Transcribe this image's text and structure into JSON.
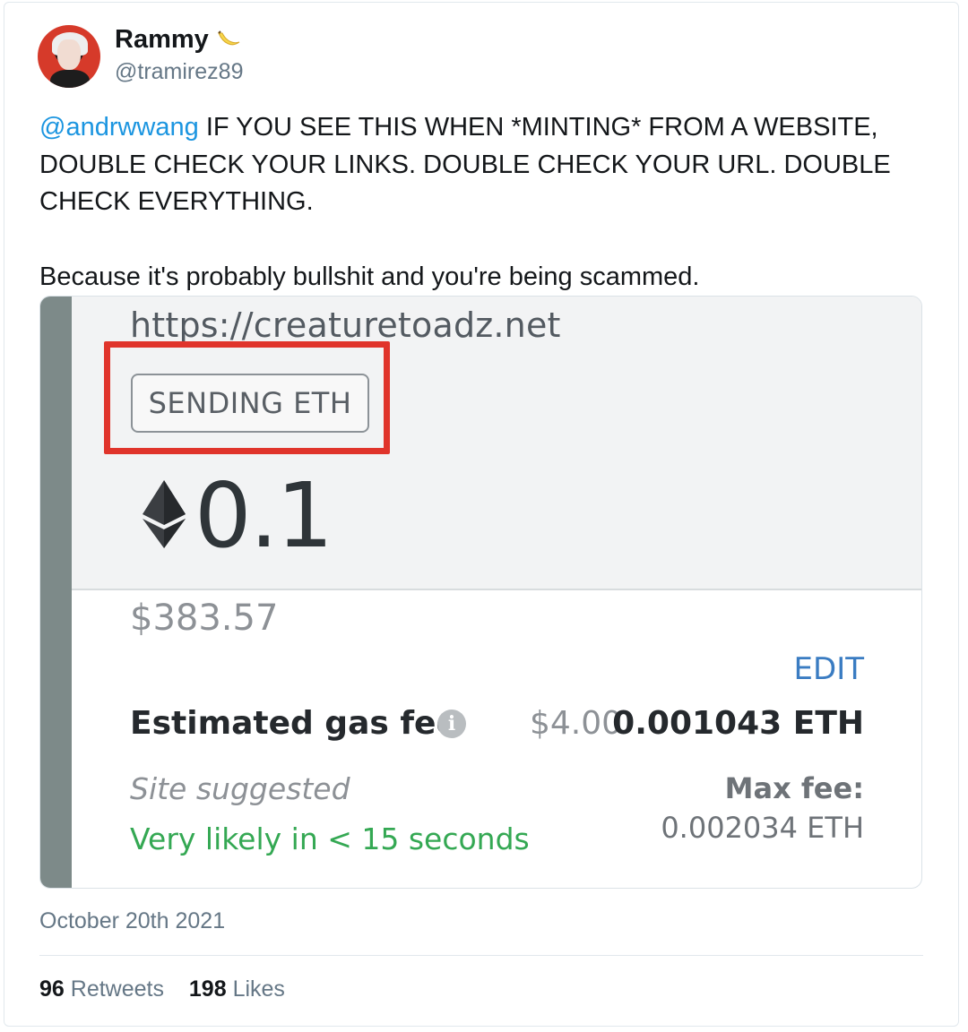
{
  "tweet": {
    "author_name": "Rammy",
    "author_handle": "@tramirez89",
    "mention": "@andrwwang",
    "text_line1_rest": " IF YOU SEE THIS WHEN *MINTING* FROM A WEBSITE, DOUBLE CHECK YOUR LINKS. DOUBLE CHECK YOUR URL. DOUBLE CHECK EVERYTHING.",
    "text_paragraph2": "Because it's probably bullshit and you're being scammed.",
    "date": "October 20th 2021",
    "retweets_count": "96",
    "retweets_label": "Retweets",
    "likes_count": "198",
    "likes_label": "Likes"
  },
  "wallet": {
    "site_url": "https://creaturetoadz.net",
    "badge": "SENDING ETH",
    "amount": "0.1",
    "usd_value": "$383.57",
    "edit_label": "EDIT",
    "gas_label": "Estimated gas fee",
    "gas_usd": "$4.00",
    "gas_eth": "0.001043 ETH",
    "site_suggested": "Site suggested",
    "likely": "Very likely in < 15 seconds",
    "max_fee_label": "Max fee:",
    "max_fee_value": "0.002034 ETH"
  },
  "colors": {
    "mention": "#1b95e0",
    "highlight_box": "#e0342b",
    "likely_green": "#34a853",
    "edit_blue": "#3a7cc2"
  },
  "icons": {
    "avatar": "user-avatar",
    "emoji": "banana-icon",
    "eth": "ethereum-icon",
    "info": "info-icon"
  }
}
